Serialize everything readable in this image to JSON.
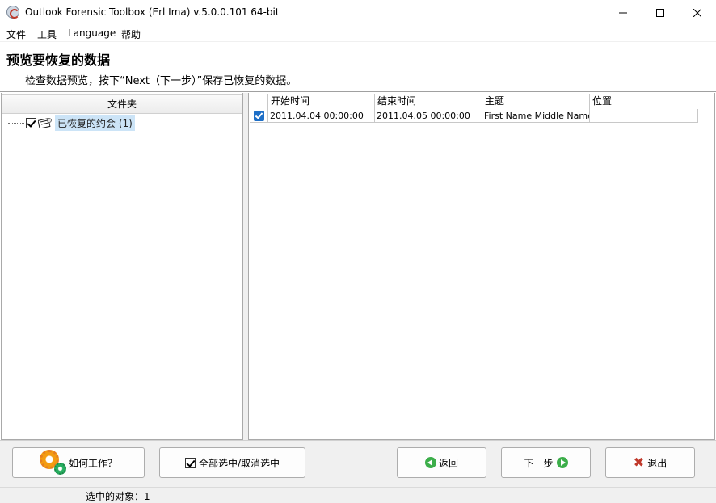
{
  "window": {
    "title": "Outlook Forensic Toolbox (Erl Ima) v.5.0.0.101 64-bit"
  },
  "menu": [
    "文件",
    "工具",
    "Language",
    "帮助"
  ],
  "header": {
    "title": "预览要恢复的数据",
    "description": "检查数据预览，按下“Next（下一步）”保存已恢复的数据。"
  },
  "folder_pane": {
    "header": "文件夹",
    "tree": [
      {
        "label": "已恢复的约会 (1)",
        "checked": true,
        "icon": "calendar-folder-icon"
      }
    ]
  },
  "grid": {
    "columns": [
      "开始时间",
      "结束时间",
      "主题",
      "位置"
    ],
    "rows": [
      {
        "checked": true,
        "start": "2011.04.04 00:00:00",
        "end": "2011.04.05 00:00:00",
        "subject": "First Name Middle Name La",
        "location": ""
      }
    ]
  },
  "buttons": {
    "how_it_works": "如何工作？",
    "select_all": "全部选中/取消选中",
    "back": "返回",
    "next": "下一步",
    "exit": "退出"
  },
  "status": {
    "selected_objects": "选中的对象：1"
  },
  "colors": {
    "accent_check": "#1e6fc7",
    "tree_highlight": "#cce4f7",
    "nav_green": "#3cae4a",
    "exit_red": "#c0392b"
  }
}
